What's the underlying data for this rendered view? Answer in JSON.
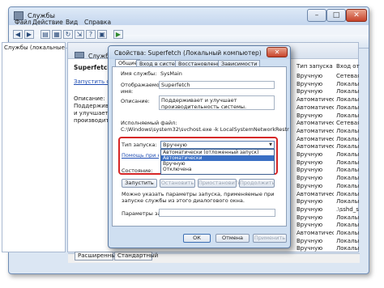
{
  "window": {
    "title": "Службы"
  },
  "menu": [
    "Файл",
    "Действие",
    "Вид",
    "Справка"
  ],
  "tree": {
    "root_label": "Службы (локальные"
  },
  "services": {
    "header_title": "Служб",
    "detail": {
      "name": "Superfetch",
      "link": "Запустить службу",
      "desc_label": "Описание:",
      "desc_text": "Поддерживает и улучшает производительность"
    },
    "columns": {
      "start_type": "Тип запуска",
      "logon_as": "Вход от им"
    },
    "rows": [
      {
        "start": "Вручную",
        "login": "Сетевая сл"
      },
      {
        "start": "Вручную",
        "login": "Локальная"
      },
      {
        "start": "Вручную",
        "login": "Локальная"
      },
      {
        "start": "Автоматически",
        "login": "Локальная"
      },
      {
        "start": "Автоматически",
        "login": "Локальная"
      },
      {
        "start": "Вручную",
        "login": "Локальная"
      },
      {
        "start": "Автоматически",
        "login": "Сетевая сл"
      },
      {
        "start": "Автоматически",
        "login": "Локальная"
      },
      {
        "start": "Автоматически",
        "login": "Локальная"
      },
      {
        "start": "Автоматически",
        "login": "Локальная"
      },
      {
        "start": "Вручную",
        "login": "Локальная"
      },
      {
        "start": "Вручную",
        "login": "Локальная"
      },
      {
        "start": "Вручную",
        "login": "Локальная"
      },
      {
        "start": "Вручную",
        "login": "Локальная"
      },
      {
        "start": "Вручную",
        "login": "Локальная"
      },
      {
        "start": "Автоматически",
        "login": "Локальная"
      },
      {
        "start": "Вручную",
        "login": "Локальная"
      },
      {
        "start": "Вручную",
        "login": ".\\sshd_se"
      },
      {
        "start": "Вручную",
        "login": "Локальная"
      },
      {
        "start": "Вручную",
        "login": "Локальная"
      },
      {
        "start": "Автоматически",
        "login": "Локальная"
      },
      {
        "start": "Вручную",
        "login": "Локальная"
      },
      {
        "start": "Вручную",
        "login": "Локальная"
      }
    ],
    "status_tabs": [
      "Расширенный",
      "Стандартный"
    ]
  },
  "dialog": {
    "title": "Свойства: Superfetch (Локальный компьютер)",
    "tabs": [
      "Общие",
      "Вход в систему",
      "Восстановление",
      "Зависимости"
    ],
    "service_name_label": "Имя службы:",
    "service_name": "SysMain",
    "display_name_label": "Отображаемое имя:",
    "display_name": "Superfetch",
    "description_label": "Описание:",
    "description": "Поддерживает и улучшает производительность системы.",
    "exe_label": "Исполняемый файл:",
    "exe_path": "C:\\Windows\\system32\\svchost.exe -k LocalSystemNetworkRestricted",
    "startup_type_label": "Тип запуска:",
    "startup_type_value": "Вручную",
    "startup_options": [
      "Автоматически (отложенный запуск)",
      "Автоматически",
      "Вручную",
      "Отключена"
    ],
    "selected_option_index": 1,
    "help_link": "Помощь при настр",
    "status_label": "Состояние:",
    "buttons": {
      "start": "Запустить",
      "stop": "Остановить",
      "pause": "Приостановить",
      "resume": "Продолжить"
    },
    "hint": "Можно указать параметры запуска, применяемые при запуске службы из этого диалогового окна.",
    "params_label": "Параметры запуска:",
    "ok": "ОК",
    "cancel": "Отмена",
    "apply": "Применить"
  }
}
